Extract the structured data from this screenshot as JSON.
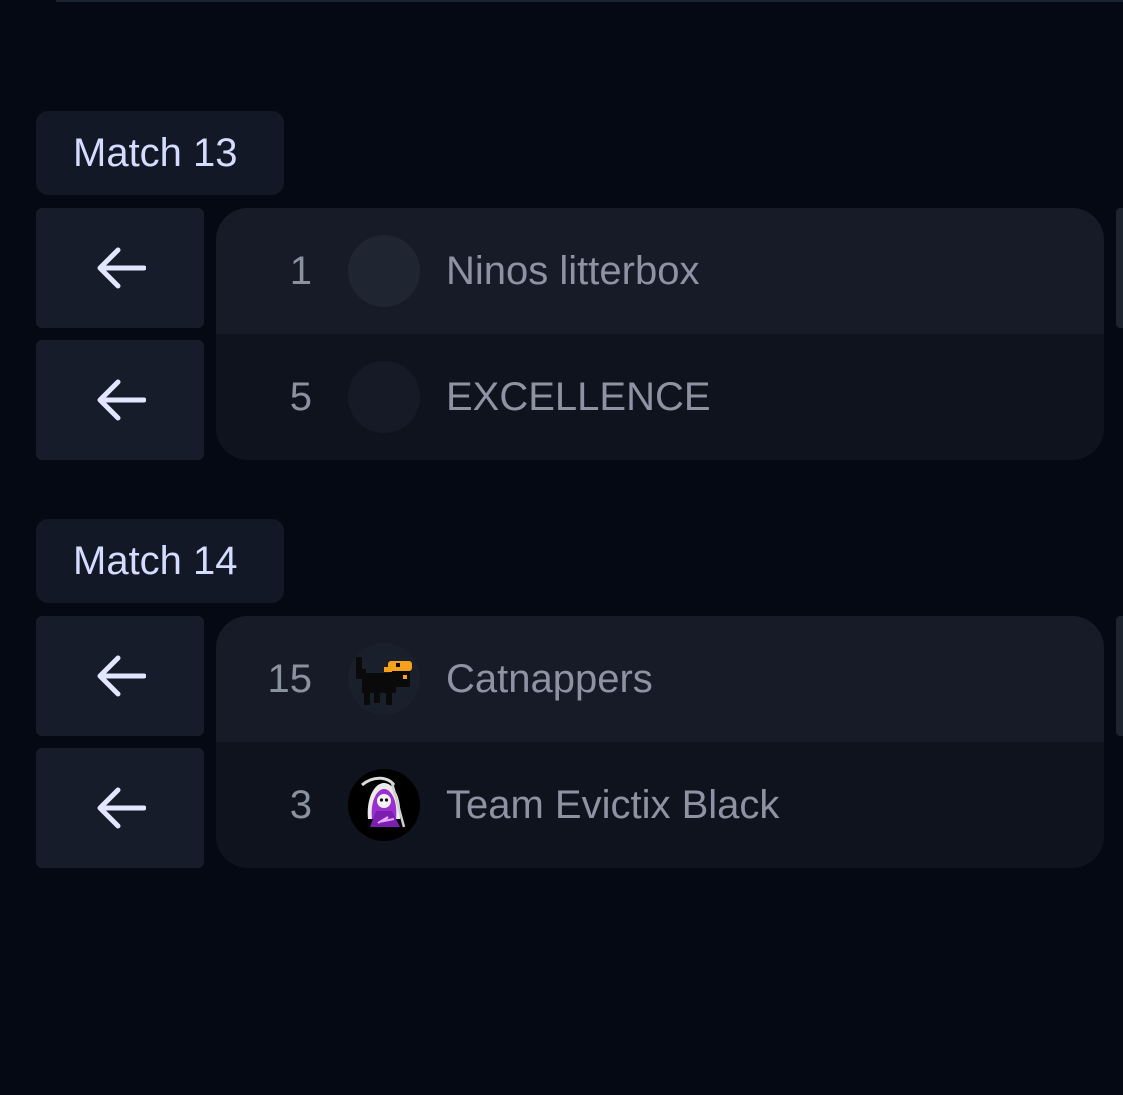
{
  "matches": [
    {
      "label": "Match 13",
      "teams": [
        {
          "seed": "1",
          "name": "Ninos litterbox",
          "logo": "empty-logo"
        },
        {
          "seed": "5",
          "name": "EXCELLENCE",
          "logo": "empty-logo"
        }
      ]
    },
    {
      "label": "Match 14",
      "teams": [
        {
          "seed": "15",
          "name": "Catnappers",
          "logo": "black-cat-logo"
        },
        {
          "seed": "3",
          "name": "Team Evictix Black",
          "logo": "grim-reaper-logo"
        }
      ]
    }
  ],
  "icons": {
    "back_arrow": "arrow-left-icon"
  },
  "colors": {
    "background": "#050914",
    "label_text": "#d4dcff",
    "team_text": "#8d93a2",
    "arrow": "#e2e6ff",
    "cat_accent": "#f5a11c",
    "reaper_accent": "#9b2fd0"
  }
}
